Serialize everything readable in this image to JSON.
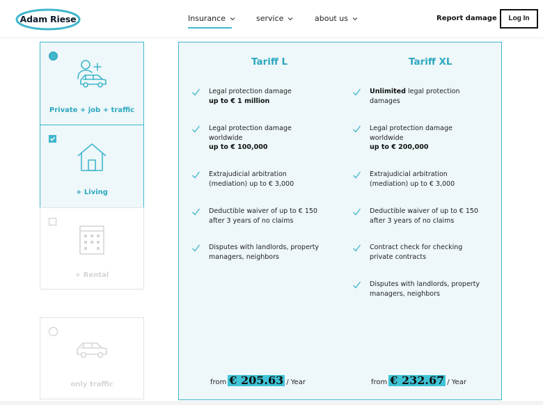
{
  "header": {
    "logo": "Adam Riese",
    "nav": {
      "insurance": "Insurance",
      "service": "service",
      "about": "about us"
    },
    "report_damage": "Report damage",
    "login": "Log In"
  },
  "options": [
    {
      "label": "Private + job + traffic",
      "control": "radio",
      "selected": true,
      "icon": "person-car-icon"
    },
    {
      "label": "+ Living",
      "control": "checkbox",
      "checked": true,
      "icon": "house-icon"
    },
    {
      "label": "+ Rental",
      "control": "checkbox",
      "checked": false,
      "icon": "building-icon"
    },
    {
      "label": "only traffic",
      "control": "radio",
      "selected": false,
      "icon": "car-icon"
    }
  ],
  "tariffs": [
    {
      "name": "Tariff L",
      "features": [
        {
          "text": "Legal protection damage",
          "bold": "up to € 1 million"
        },
        {
          "text": "Legal protection damage worldwide",
          "bold": "up to € 100,000"
        },
        {
          "text": "Extrajudicial arbitration (mediation) up to € 3,000"
        },
        {
          "text": "Deductible waiver of up to € 150 after 3 years of no claims"
        },
        {
          "text": "Disputes with landlords, property managers, neighbors"
        }
      ],
      "price": {
        "prefix": "from",
        "amount": "€ 205.63",
        "period": "/ Year"
      }
    },
    {
      "name": "Tariff XL",
      "features": [
        {
          "bold_lead": "Unlimited",
          "text": " legal protection damages"
        },
        {
          "text": "Legal protection damage worldwide",
          "bold": "up to € 200,000"
        },
        {
          "text": "Extrajudicial arbitration (mediation) up to € 3,000"
        },
        {
          "text": "Deductible waiver of up to € 150 after 3 years of no claims"
        },
        {
          "text": "Contract check for checking private contracts"
        },
        {
          "text": "Disputes with landlords, property managers, neighbors"
        }
      ],
      "price": {
        "prefix": "from",
        "amount": "€ 232.67",
        "period": "/ Year"
      }
    }
  ],
  "colors": {
    "accent": "#3fb6cc",
    "panel_bg": "#eef7f9",
    "price_highlight": "#3fc3d6",
    "inactive": "#d5d5d5"
  }
}
